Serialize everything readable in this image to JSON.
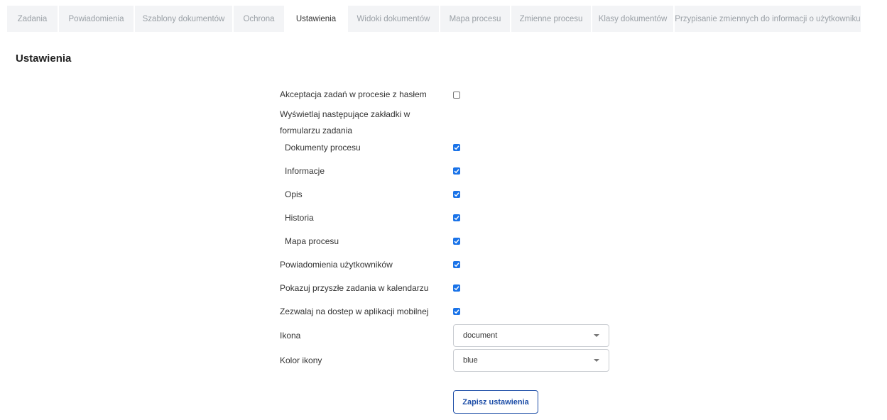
{
  "tabs": [
    {
      "label": "Zadania",
      "active": false
    },
    {
      "label": "Powiadomienia",
      "active": false
    },
    {
      "label": "Szablony dokumentów",
      "active": false
    },
    {
      "label": "Ochrona",
      "active": false
    },
    {
      "label": "Ustawienia",
      "active": true
    },
    {
      "label": "Widoki dokumentów",
      "active": false
    },
    {
      "label": "Mapa procesu",
      "active": false
    },
    {
      "label": "Zmienne procesu",
      "active": false
    },
    {
      "label": "Klasy dokumentów",
      "active": false
    },
    {
      "label": "Przypisanie zmiennych do informacji o użytkowniku",
      "active": false
    }
  ],
  "page_title": "Ustawienia",
  "settings": {
    "accept_with_password": {
      "label": "Akceptacja zadań w procesie z hasłem",
      "checked": false
    },
    "tabs_group_label": "Wyświetlaj następujące zakładki w formularzu zadania",
    "tab_options": [
      {
        "label": "Dokumenty procesu",
        "checked": true
      },
      {
        "label": "Informacje",
        "checked": true
      },
      {
        "label": "Opis",
        "checked": true
      },
      {
        "label": "Historia",
        "checked": true
      },
      {
        "label": "Mapa procesu",
        "checked": true
      }
    ],
    "user_notifications": {
      "label": "Powiadomienia użytkowników",
      "checked": true
    },
    "future_tasks_calendar": {
      "label": "Pokazuj przyszłe zadania w kalendarzu",
      "checked": true
    },
    "mobile_access": {
      "label": "Zezwalaj na dostep w aplikacji mobilnej",
      "checked": true
    },
    "icon": {
      "label": "Ikona",
      "value": "document"
    },
    "icon_color": {
      "label": "Kolor ikony",
      "value": "blue"
    }
  },
  "save_button": "Zapisz ustawienia",
  "colors": {
    "accent": "#1a73e8",
    "button_border": "#1f4fa8",
    "tab_bg": "#f3f4f6"
  }
}
